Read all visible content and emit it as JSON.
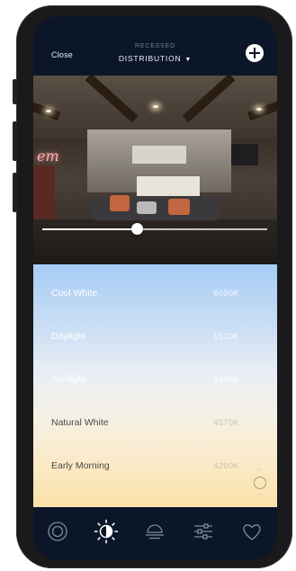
{
  "header": {
    "close_label": "Close",
    "subtitle": "RECESSED",
    "title": "DISTRIBUTION",
    "title_caret_icon": "caret-down-icon",
    "add_icon": "plus-circle-icon"
  },
  "preview": {
    "neon_text": "em",
    "slider_value": 0.42
  },
  "temperatures": [
    {
      "name": "Cool White",
      "value": "6000K"
    },
    {
      "name": "Daylight",
      "value": "5520K"
    },
    {
      "name": "Sunlight",
      "value": "3600K"
    },
    {
      "name": "Natural White",
      "value": "4570K"
    },
    {
      "name": "Early Morning",
      "value": "4200K"
    }
  ],
  "tabs": [
    {
      "icon": "target-icon",
      "active": false
    },
    {
      "icon": "sun-brightness-icon",
      "active": true
    },
    {
      "icon": "lamp-icon",
      "active": false
    },
    {
      "icon": "sliders-icon",
      "active": false
    },
    {
      "icon": "heart-icon",
      "active": false
    }
  ],
  "colors": {
    "header_bg": "#0b1629",
    "accent": "#ffffff",
    "cool": "#a7cdf6",
    "warm": "#fbe0a8"
  }
}
